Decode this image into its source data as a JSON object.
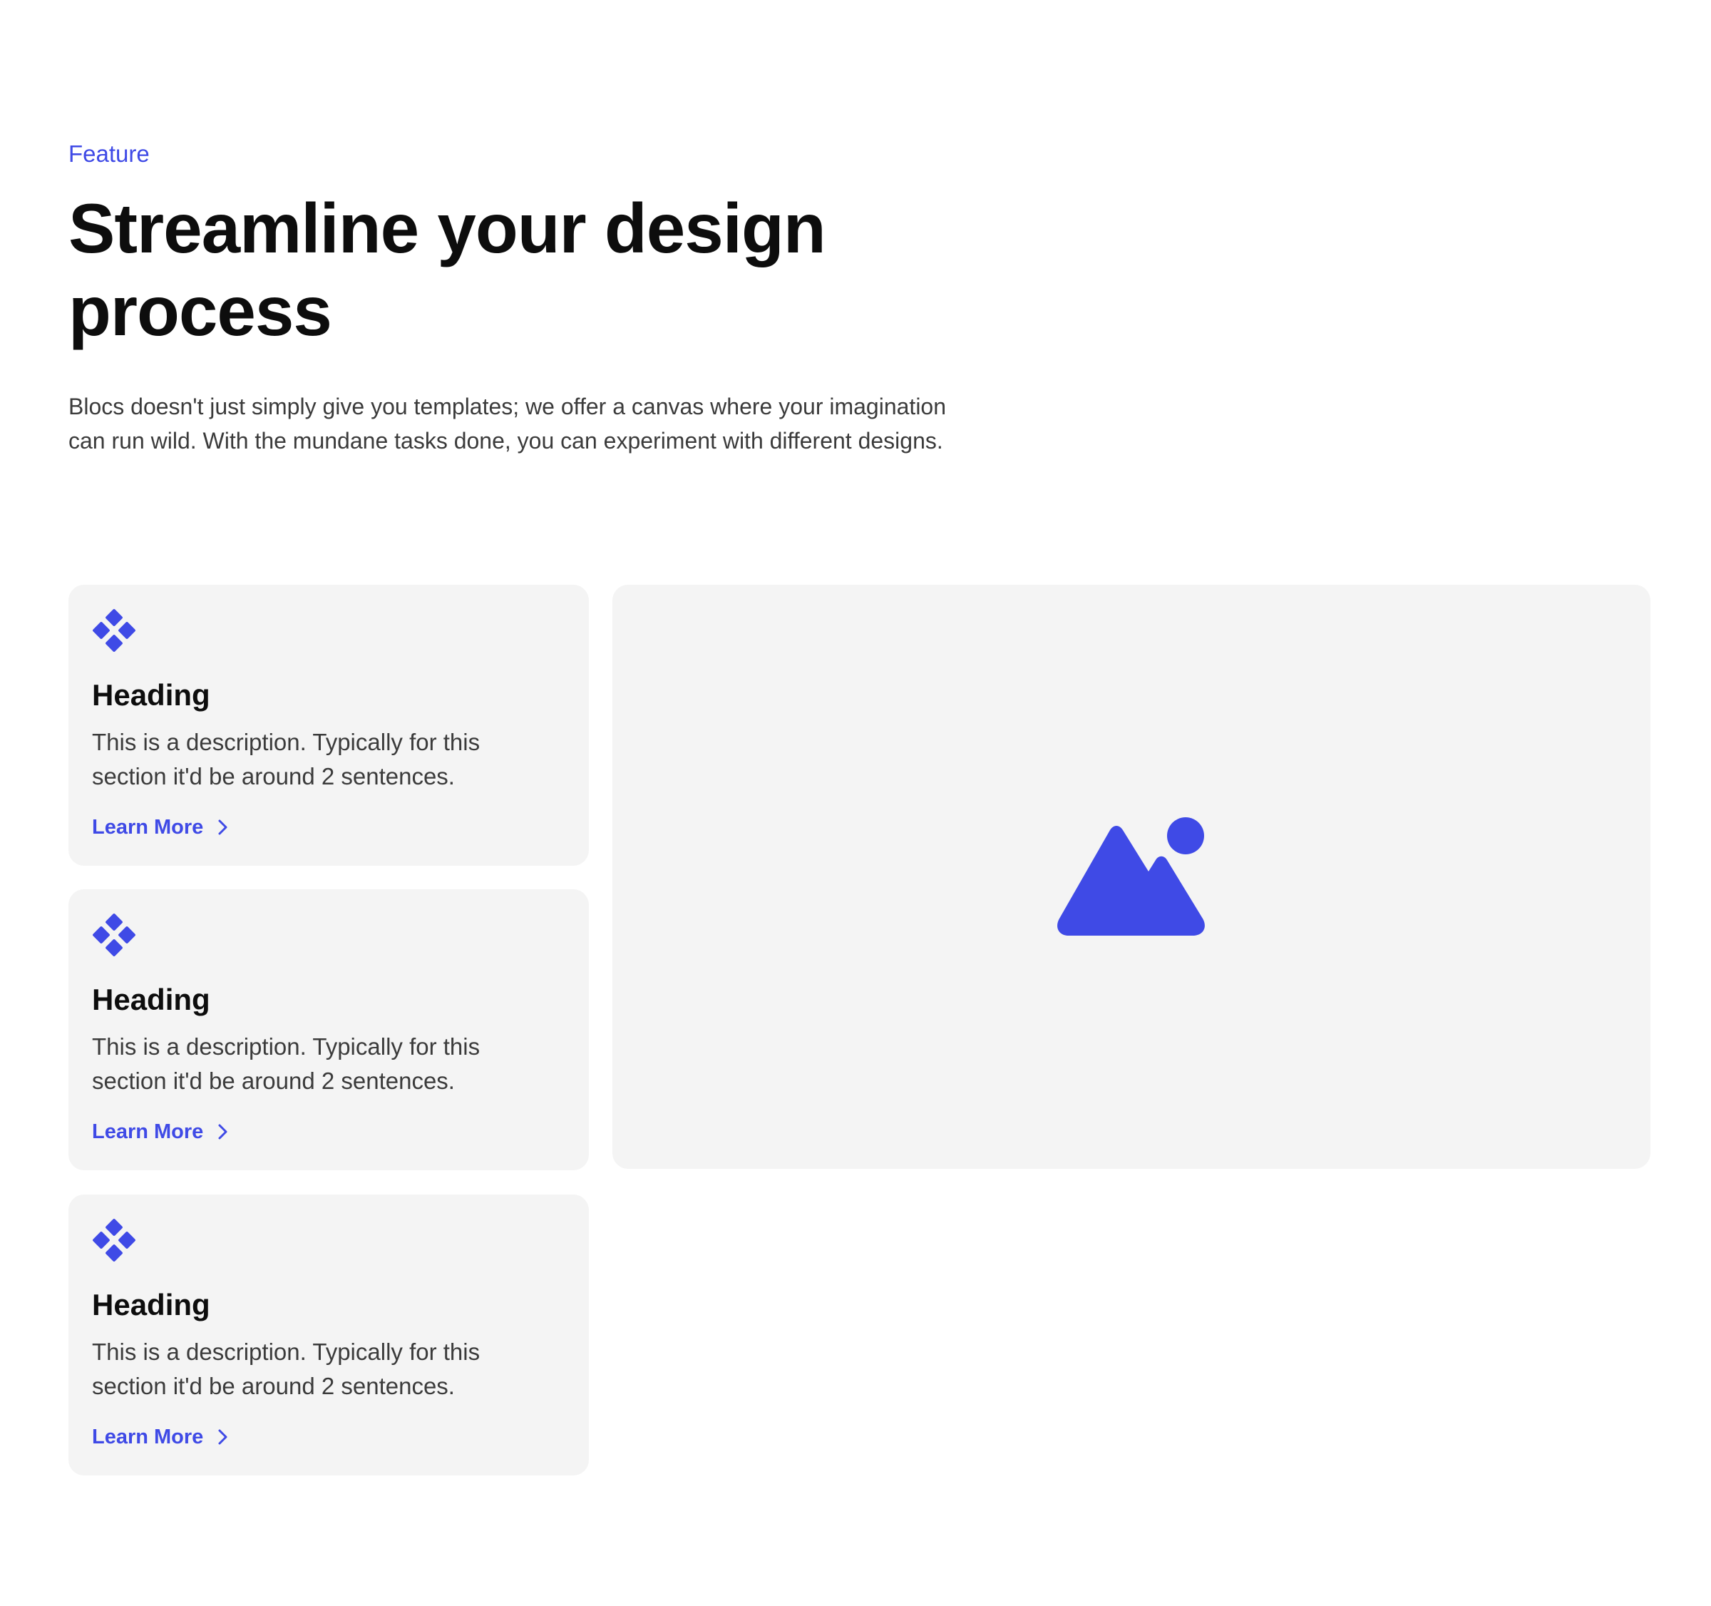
{
  "header": {
    "eyebrow": "Feature",
    "title": "Streamline your design process",
    "description": "Blocs doesn't just simply give you templates; we offer a canvas where your imagination can run wild. With the mundane tasks done, you can experiment with different designs."
  },
  "features": [
    {
      "icon": "diamond-grid-icon",
      "heading": "Heading",
      "description": "This is a description. Typically for this section it'd be around 2 sentences.",
      "link_label": "Learn More"
    },
    {
      "icon": "diamond-grid-icon",
      "heading": "Heading",
      "description": "This is a description. Typically for this section it'd be around 2 sentences.",
      "link_label": "Learn More"
    },
    {
      "icon": "diamond-grid-icon",
      "heading": "Heading",
      "description": "This is a description. Typically for this section it'd be around 2 sentences.",
      "link_label": "Learn More"
    }
  ],
  "media": {
    "icon": "image-placeholder-icon"
  },
  "colors": {
    "accent": "#3f4ae6",
    "card_background": "#f4f4f4",
    "heading_text": "#0d0d0d",
    "body_text": "#3b3b3b"
  }
}
